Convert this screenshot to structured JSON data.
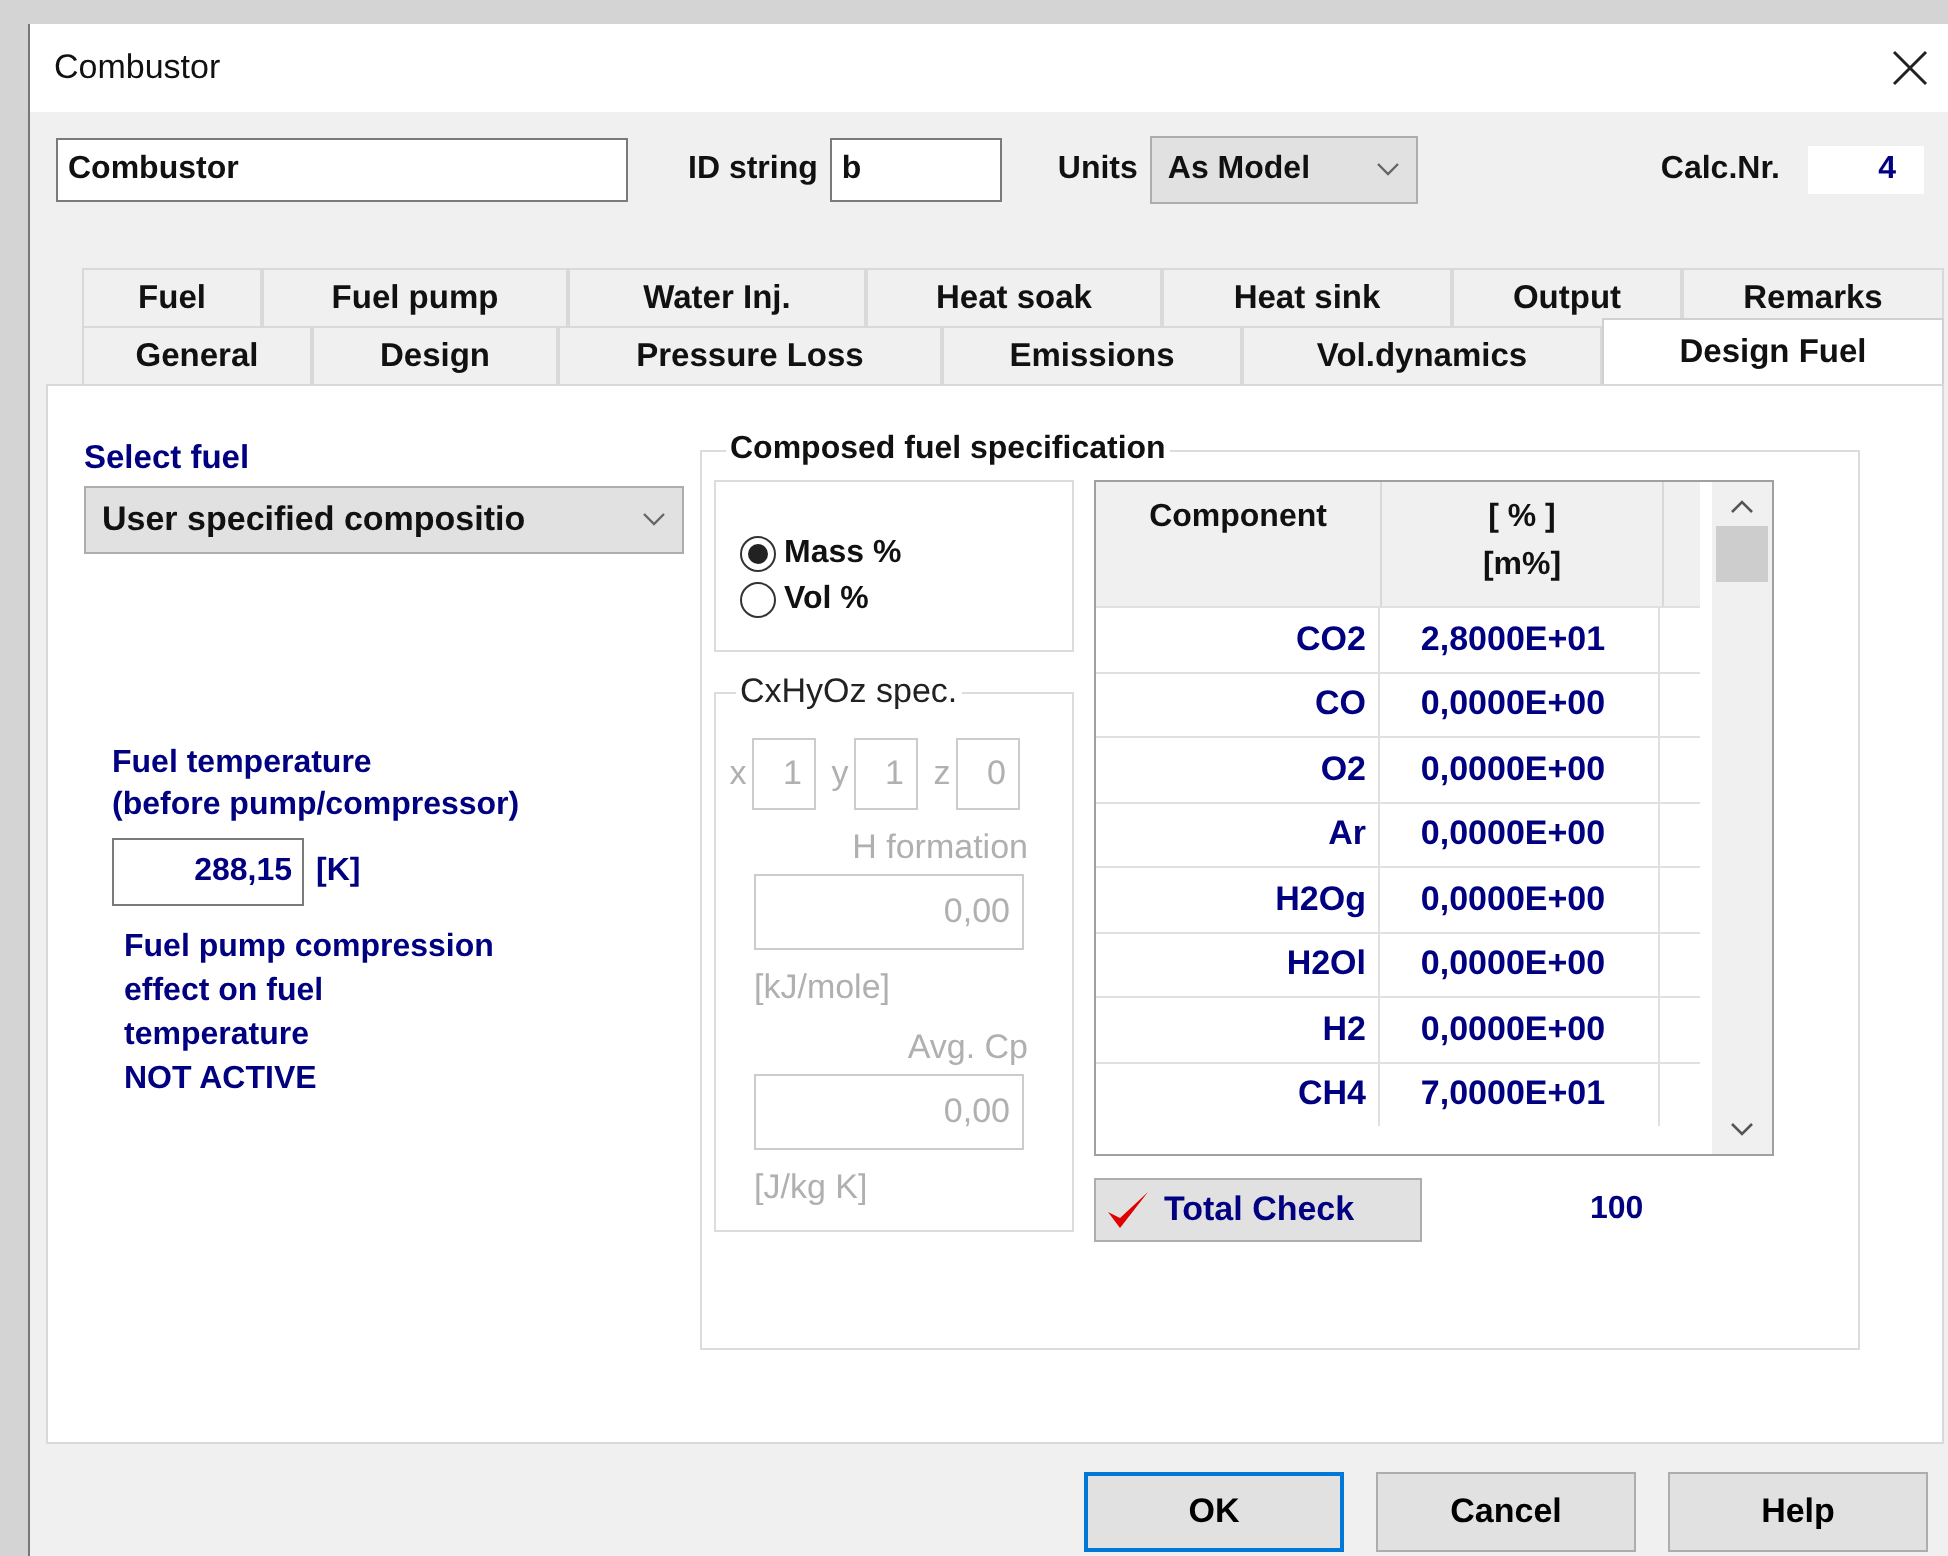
{
  "window": {
    "title": "Combustor"
  },
  "name_field": {
    "value": "Combustor"
  },
  "id_string": {
    "label": "ID string",
    "value": "b"
  },
  "units": {
    "label": "Units",
    "value": "As Model"
  },
  "calc_nr": {
    "label": "Calc.Nr.",
    "value": "4"
  },
  "tab_rows": [
    [
      {
        "label": "Fuel",
        "selected": false
      },
      {
        "label": "Fuel pump",
        "selected": false
      },
      {
        "label": "Water Inj.",
        "selected": false
      },
      {
        "label": "Heat soak",
        "selected": false
      },
      {
        "label": "Heat sink",
        "selected": false
      },
      {
        "label": "Output",
        "selected": false
      },
      {
        "label": "Remarks",
        "selected": false
      }
    ],
    [
      {
        "label": "General",
        "selected": false
      },
      {
        "label": "Design",
        "selected": false
      },
      {
        "label": "Pressure Loss",
        "selected": false
      },
      {
        "label": "Emissions",
        "selected": false
      },
      {
        "label": "Vol.dynamics",
        "selected": false
      },
      {
        "label": "Design Fuel",
        "selected": true
      }
    ]
  ],
  "select_fuel": {
    "label": "Select fuel",
    "value": "User specified compositio"
  },
  "fuel_temperature": {
    "label": "Fuel temperature\n(before pump/compressor)",
    "value": "288,15",
    "unit": "[K]"
  },
  "pump_effect": {
    "text": "Fuel pump compression\neffect on fuel\ntemperature",
    "status": "NOT ACTIVE"
  },
  "composition": {
    "title": "Composed fuel specification",
    "basis": [
      {
        "label": "Mass %",
        "selected": true
      },
      {
        "label": "Vol %",
        "selected": false
      }
    ],
    "cxhyoz": {
      "title": "CxHyOz spec.",
      "disabled": true,
      "coefficients": [
        {
          "label": "x",
          "value": "1"
        },
        {
          "label": "y",
          "value": "1"
        },
        {
          "label": "z",
          "value": "0"
        }
      ],
      "h_formation": {
        "label": "H formation",
        "value": "0,00",
        "unit": "[kJ/mole]"
      },
      "avg_cp": {
        "label": "Avg. Cp",
        "value": "0,00",
        "unit": "[J/kg K]"
      }
    },
    "table": {
      "columns": [
        "Component",
        "[ % ]\n[m%]"
      ],
      "rows": [
        [
          "CO2",
          "2,8000E+01"
        ],
        [
          "CO",
          "0,0000E+00"
        ],
        [
          "O2",
          "0,0000E+00"
        ],
        [
          "Ar",
          "0,0000E+00"
        ],
        [
          "H2Og",
          "0,0000E+00"
        ],
        [
          "H2Ol",
          "0,0000E+00"
        ],
        [
          "H2",
          "0,0000E+00"
        ],
        [
          "CH4",
          "7,0000E+01"
        ]
      ]
    },
    "total_check": {
      "label": "Total Check",
      "value": "100"
    }
  },
  "buttons": [
    {
      "label": "OK",
      "default": true
    },
    {
      "label": "Cancel",
      "default": false
    },
    {
      "label": "Help",
      "default": false
    }
  ]
}
